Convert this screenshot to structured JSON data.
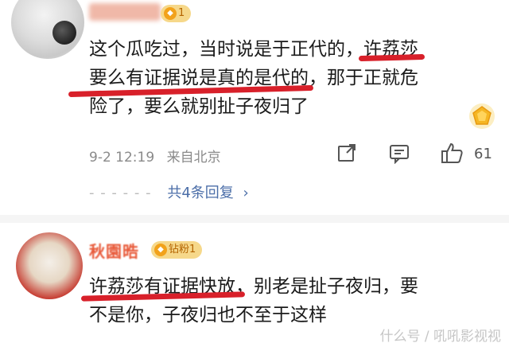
{
  "comment1": {
    "fan_badge": "1",
    "lines": [
      "这个瓜吃过，当时说是于正代的，",
      "许荔莎",
      "要么有证据说是真的是代的",
      "，那于正就危",
      "险了，要么就别扯子夜归了"
    ],
    "time": "9-2 12:19",
    "location": "来自北京",
    "like_count": "61",
    "replies_label": "共4条回复",
    "reply_dashes": "- - - - - -"
  },
  "comment2": {
    "username": "秋園晧",
    "fan_badge": "钻粉1",
    "lines": [
      "许荔莎有证据快放",
      "，别老是扯子夜归，要",
      "不是你，子夜归也不至于这样"
    ]
  },
  "watermark": "什么号 / 吼吼影视视",
  "icons": {
    "share": "share-icon",
    "comment": "comment-icon",
    "like": "thumbs-up-icon",
    "chevron": "chevron-right-icon",
    "gold": "gold-rank-icon"
  },
  "colors": {
    "underline": "#d8202a",
    "link": "#4b6ea8",
    "badge": "#f6d88a"
  }
}
